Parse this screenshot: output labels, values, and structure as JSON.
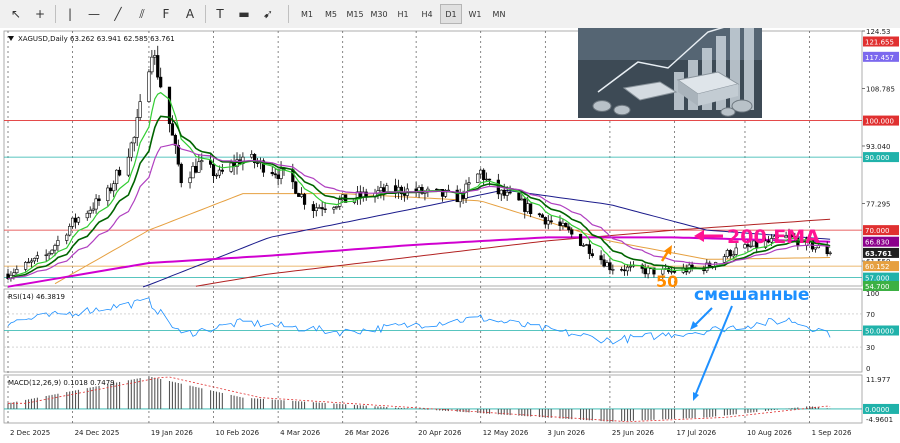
{
  "toolbar": {
    "tools": [
      {
        "name": "cursor-icon",
        "glyph": "↖"
      },
      {
        "name": "crosshair-icon",
        "glyph": "+"
      },
      {
        "name": "vertical-line-icon",
        "glyph": "|"
      },
      {
        "name": "horizontal-line-icon",
        "glyph": "—"
      },
      {
        "name": "trendline-icon",
        "glyph": "╱"
      },
      {
        "name": "channel-icon",
        "glyph": "⫽"
      },
      {
        "name": "fibonacci-icon",
        "glyph": "F"
      },
      {
        "name": "text-icon",
        "glyph": "A"
      },
      {
        "name": "text-label-icon",
        "glyph": "T"
      },
      {
        "name": "shapes-icon",
        "glyph": "▬"
      },
      {
        "name": "arrows-icon",
        "glyph": "➹"
      }
    ],
    "timeframes": [
      "M1",
      "M5",
      "M15",
      "M30",
      "H1",
      "H4",
      "D1",
      "W1",
      "MN"
    ],
    "selected_timeframe": "D1"
  },
  "chart_data": {
    "type": "candlestick",
    "symbol_info": "XAGUSD,Daily  63.262 63.941 62.585 63.761",
    "x_tick_labels": [
      "2 Dec 2025",
      "24 Dec 2025",
      "19 Jan 2026",
      "10 Feb 2026",
      "4 Mar 2026",
      "26 Mar 2026",
      "20 Apr 2026",
      "12 May 2026",
      "3 Jun 2026",
      "25 Jun 2026",
      "17 Jul 2026",
      "10 Aug 2026",
      "1 Sep 2026"
    ],
    "price_axis_ticks": [
      124.53,
      108.785,
      93.04,
      77.295,
      61.55
    ],
    "ylim": [
      54.7,
      124.53
    ],
    "ohlc_anchors": [
      {
        "date": "2025-12-02",
        "close": 58.0
      },
      {
        "date": "2025-12-15",
        "close": 63.0
      },
      {
        "date": "2025-12-24",
        "close": 72.0
      },
      {
        "date": "2026-01-05",
        "close": 80.0
      },
      {
        "date": "2026-01-14",
        "close": 95.0
      },
      {
        "date": "2026-01-20",
        "close": 120.0
      },
      {
        "date": "2026-01-25",
        "close": 103.0
      },
      {
        "date": "2026-01-30",
        "close": 84.0
      },
      {
        "date": "2026-02-05",
        "close": 88.0
      },
      {
        "date": "2026-02-12",
        "close": 85.0
      },
      {
        "date": "2026-02-20",
        "close": 90.0
      },
      {
        "date": "2026-03-01",
        "close": 87.0
      },
      {
        "date": "2026-03-08",
        "close": 84.0
      },
      {
        "date": "2026-03-15",
        "close": 76.0
      },
      {
        "date": "2026-03-26",
        "close": 78.0
      },
      {
        "date": "2026-04-05",
        "close": 80.0
      },
      {
        "date": "2026-04-15",
        "close": 81.0
      },
      {
        "date": "2026-04-25",
        "close": 80.0
      },
      {
        "date": "2026-05-05",
        "close": 79.0
      },
      {
        "date": "2026-05-12",
        "close": 86.0
      },
      {
        "date": "2026-05-16",
        "close": 81.0
      },
      {
        "date": "2026-05-24",
        "close": 78.0
      },
      {
        "date": "2026-06-01",
        "close": 74.0
      },
      {
        "date": "2026-06-10",
        "close": 70.0
      },
      {
        "date": "2026-06-18",
        "close": 65.0
      },
      {
        "date": "2026-06-25",
        "close": 60.0
      },
      {
        "date": "2026-07-05",
        "close": 59.0
      },
      {
        "date": "2026-07-15",
        "close": 58.5
      },
      {
        "date": "2026-07-28",
        "close": 60.0
      },
      {
        "date": "2026-08-05",
        "close": 64.0
      },
      {
        "date": "2026-08-15",
        "close": 66.0
      },
      {
        "date": "2026-08-25",
        "close": 68.0
      },
      {
        "date": "2026-09-01",
        "close": 66.0
      },
      {
        "date": "2026-09-08",
        "close": 63.761
      }
    ],
    "ema200_anchors": [
      {
        "date": "2025-12-02",
        "value": 54.5
      },
      {
        "date": "2026-01-19",
        "value": 61.0
      },
      {
        "date": "2026-03-01",
        "value": 63.0
      },
      {
        "date": "2026-04-20",
        "value": 66.0
      },
      {
        "date": "2026-06-03",
        "value": 68.0
      },
      {
        "date": "2026-07-17",
        "value": 68.0
      },
      {
        "date": "2026-09-08",
        "value": 66.83
      }
    ],
    "sma200_anchors": [
      {
        "date": "2025-12-02",
        "value": 46.0
      },
      {
        "date": "2026-03-01",
        "value": 58.0
      },
      {
        "date": "2026-06-03",
        "value": 67.0
      },
      {
        "date": "2026-07-17",
        "value": 70.0
      },
      {
        "date": "2026-09-08",
        "value": 73.0
      }
    ],
    "ma100_anchors": [
      {
        "date": "2025-12-02",
        "value": 42.0
      },
      {
        "date": "2026-01-19",
        "value": 55.0
      },
      {
        "date": "2026-03-01",
        "value": 68.0
      },
      {
        "date": "2026-04-20",
        "value": 76.0
      },
      {
        "date": "2026-05-20",
        "value": 81.0
      },
      {
        "date": "2026-06-25",
        "value": 77.0
      },
      {
        "date": "2026-07-28",
        "value": 70.0
      },
      {
        "date": "2026-09-08",
        "value": 67.5
      }
    ],
    "ema50_anchors": [
      {
        "date": "2025-12-02",
        "value": 48.0
      },
      {
        "date": "2026-01-19",
        "value": 70.0
      },
      {
        "date": "2026-02-20",
        "value": 80.0
      },
      {
        "date": "2026-03-26",
        "value": 80.0
      },
      {
        "date": "2026-05-12",
        "value": 78.0
      },
      {
        "date": "2026-06-25",
        "value": 67.0
      },
      {
        "date": "2026-07-28",
        "value": 62.0
      },
      {
        "date": "2026-09-08",
        "value": 62.5
      }
    ],
    "horizontal_levels": [
      {
        "value": 121.655,
        "label": "121.655",
        "color": "#e03030",
        "line": false
      },
      {
        "value": 117.457,
        "label": "117.457",
        "color": "#7b68ee",
        "line": false
      },
      {
        "value": 100.0,
        "label": "100.000",
        "color": "#e03030",
        "line": true
      },
      {
        "value": 90.0,
        "label": "90.000",
        "color": "#20b2aa",
        "line": true
      },
      {
        "value": 70.0,
        "label": "70.000",
        "color": "#e03030",
        "line": true
      },
      {
        "value": 66.83,
        "label": "66.830",
        "color": "#8b008b",
        "line": false
      },
      {
        "value": 63.761,
        "label": "63.761",
        "color": "#202020",
        "line": false
      },
      {
        "value": 60.152,
        "label": "60.152",
        "color": "#e6a040",
        "line": true
      },
      {
        "value": 57.0,
        "label": "57.000",
        "color": "#20b2aa",
        "line": true
      },
      {
        "value": 54.7,
        "label": "54.700",
        "color": "#3cb043",
        "line": false
      }
    ],
    "rsi": {
      "label": "RSI(14) 46.3819",
      "current": 46.3819,
      "levels": [
        50
      ],
      "axis_ticks": [
        "100",
        "70",
        "50.0000",
        "30",
        "0"
      ],
      "anchors": [
        {
          "date": "2025-12-02",
          "value": 60
        },
        {
          "date": "2026-01-19",
          "value": 85
        },
        {
          "date": "2026-01-30",
          "value": 45
        },
        {
          "date": "2026-02-20",
          "value": 60
        },
        {
          "date": "2026-03-26",
          "value": 48
        },
        {
          "date": "2026-05-12",
          "value": 65
        },
        {
          "date": "2026-06-25",
          "value": 38
        },
        {
          "date": "2026-07-28",
          "value": 50
        },
        {
          "date": "2026-08-25",
          "value": 63
        },
        {
          "date": "2026-09-08",
          "value": 46.38
        }
      ]
    },
    "macd": {
      "label": "MACD(12,26,9) 0.1018 0.7479",
      "main": 0.1018,
      "signal": 0.7479,
      "axis_ticks": [
        "11.977",
        "0.0000",
        "-4.9601"
      ],
      "anchors": [
        {
          "date": "2025-12-02",
          "value": 2
        },
        {
          "date": "2026-01-19",
          "value": 11.5
        },
        {
          "date": "2026-02-20",
          "value": 4
        },
        {
          "date": "2026-04-20",
          "value": 0
        },
        {
          "date": "2026-06-25",
          "value": -4.5
        },
        {
          "date": "2026-07-28",
          "value": -3
        },
        {
          "date": "2026-09-01",
          "value": 1
        },
        {
          "date": "2026-09-08",
          "value": 0.1018
        }
      ]
    },
    "annotations": [
      {
        "text": "200 EMA",
        "color": "#ff1493"
      },
      {
        "text": "50",
        "color": "#ff8c00"
      },
      {
        "text": "смешанные",
        "color": "#1e90ff"
      }
    ]
  }
}
